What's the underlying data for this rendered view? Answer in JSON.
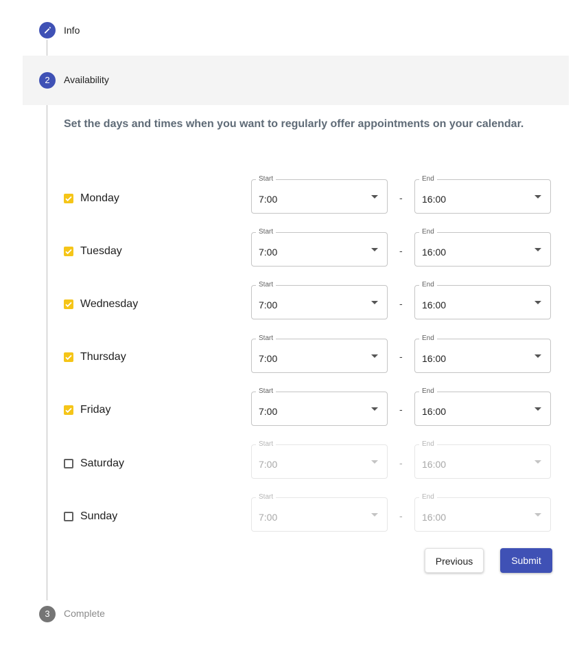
{
  "colors": {
    "primary": "#3f51b5",
    "checkbox_checked": "#f5c518",
    "step_disabled": "#757575",
    "description": "#5f6b77",
    "active_step_background": "#f4f4f4"
  },
  "stepper": {
    "steps": [
      {
        "label": "Info",
        "icon": "pencil-icon",
        "state": "completed"
      },
      {
        "label": "Availability",
        "number": "2",
        "state": "active"
      },
      {
        "label": "Complete",
        "number": "3",
        "state": "pending"
      }
    ]
  },
  "availability": {
    "description": "Set the days and times when you want to regularly offer appointments on your calendar.",
    "start_label": "Start",
    "end_label": "End",
    "separator": "-",
    "days": [
      {
        "name": "Monday",
        "checked": true,
        "start": "7:00",
        "end": "16:00"
      },
      {
        "name": "Tuesday",
        "checked": true,
        "start": "7:00",
        "end": "16:00"
      },
      {
        "name": "Wednesday",
        "checked": true,
        "start": "7:00",
        "end": "16:00"
      },
      {
        "name": "Thursday",
        "checked": true,
        "start": "7:00",
        "end": "16:00"
      },
      {
        "name": "Friday",
        "checked": true,
        "start": "7:00",
        "end": "16:00"
      },
      {
        "name": "Saturday",
        "checked": false,
        "start": "7:00",
        "end": "16:00"
      },
      {
        "name": "Sunday",
        "checked": false,
        "start": "7:00",
        "end": "16:00"
      }
    ]
  },
  "actions": {
    "previous_label": "Previous",
    "submit_label": "Submit"
  }
}
